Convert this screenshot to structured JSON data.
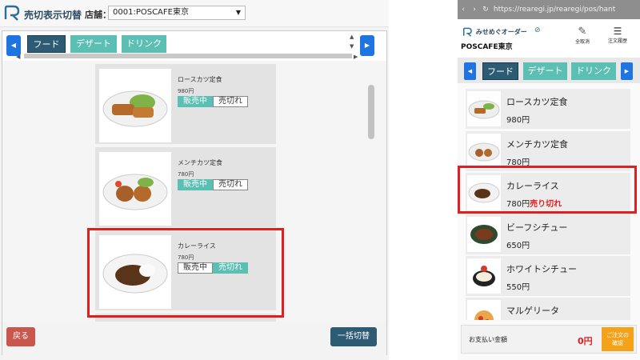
{
  "left": {
    "title": "売切表示切替",
    "store_label": "店舗：",
    "store_value": "0001:POSCAFE東京",
    "categories": [
      "フード",
      "デザート",
      "ドリンク"
    ],
    "items": [
      {
        "name": "ロースカツ定食",
        "price": "980円",
        "sale_label": "販売中",
        "sold_label": "売切れ",
        "status": "on-sale"
      },
      {
        "name": "メンチカツ定食",
        "price": "780円",
        "sale_label": "販売中",
        "sold_label": "売切れ",
        "status": "on-sale"
      },
      {
        "name": "カレーライス",
        "price": "780円",
        "sale_label": "販売中",
        "sold_label": "売切れ",
        "status": "sold-out"
      }
    ],
    "back_label": "戻る",
    "bulk_label": "一括切替"
  },
  "right": {
    "url": "https://rearegi.jp/rearegi/pos/hant",
    "logo_text": "みせめぐオーダー",
    "store_name": "POSCAFE東京",
    "clear_all_label": "全取消",
    "history_label": "注文履歴",
    "categories": [
      "フード",
      "デザート",
      "ドリンク"
    ],
    "items": [
      {
        "name": "ロースカツ定食",
        "price": "980円",
        "sold_out": ""
      },
      {
        "name": "メンチカツ定食",
        "price": "780円",
        "sold_out": ""
      },
      {
        "name": "カレーライス",
        "price": "780円",
        "sold_out": "売り切れ"
      },
      {
        "name": "ビーフシチュー",
        "price": "650円",
        "sold_out": ""
      },
      {
        "name": "ホワイトシチュー",
        "price": "550円",
        "sold_out": ""
      },
      {
        "name": "マルゲリータ",
        "price": "",
        "sold_out": ""
      }
    ],
    "payment_label": "お支払い金額",
    "total": "0円",
    "confirm_label_1": "ご注文の",
    "confirm_label_2": "確認"
  },
  "colors": {
    "accent_dark": "#2e5b74",
    "accent_teal": "#5cbfb3",
    "nav_blue": "#1e74e0",
    "highlight_red": "#e02020",
    "confirm_orange": "#f5a21b"
  }
}
